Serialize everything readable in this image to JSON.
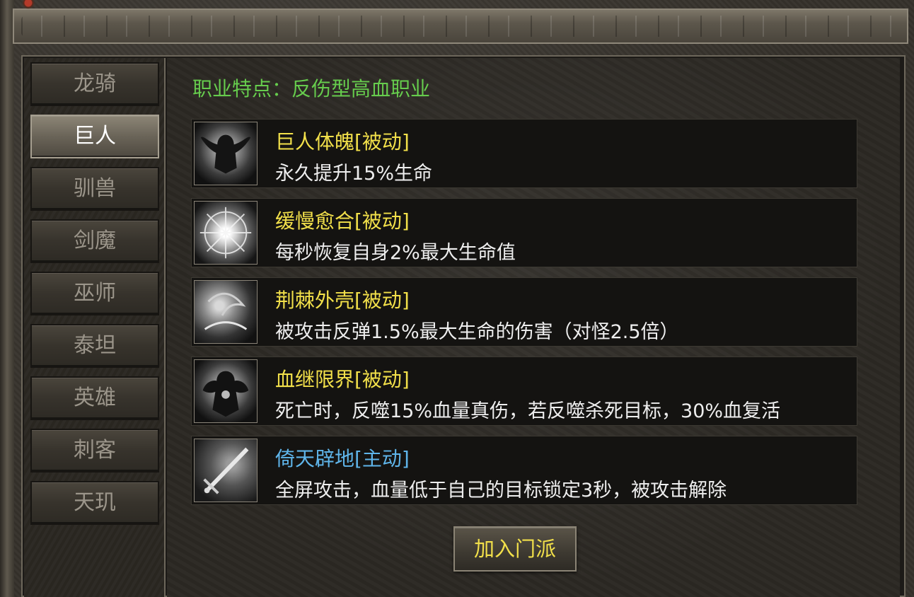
{
  "tabs": [
    {
      "label": "龙骑",
      "active": false
    },
    {
      "label": "巨人",
      "active": true
    },
    {
      "label": "驯兽",
      "active": false
    },
    {
      "label": "剑魔",
      "active": false
    },
    {
      "label": "巫师",
      "active": false
    },
    {
      "label": "泰坦",
      "active": false
    },
    {
      "label": "英雄",
      "active": false
    },
    {
      "label": "刺客",
      "active": false
    },
    {
      "label": "天玑",
      "active": false
    }
  ],
  "trait": "职业特点：反伤型高血职业",
  "skills": [
    {
      "name": "巨人体魄[被动]",
      "desc": "永久提升15%生命",
      "icon": "giant-body-icon"
    },
    {
      "name": "缓慢愈合[被动]",
      "desc": "每秒恢复自身2%最大生命值",
      "icon": "radiant-heal-icon"
    },
    {
      "name": "荆棘外壳[被动]",
      "desc": "被攻击反弹1.5%最大生命的伤害（对怪2.5倍）",
      "icon": "thorn-shell-icon"
    },
    {
      "name": "血继限界[被动]",
      "desc": "死亡时，反噬15%血量真伤，若反噬杀死目标，30%血复活",
      "icon": "bloodline-limit-icon"
    },
    {
      "name": "倚天辟地[主动]",
      "desc": "全屏攻击，血量低于自己的目标锁定3秒，被攻击解除",
      "icon": "sword-strike-icon"
    }
  ],
  "join_button": "加入门派",
  "colors": {
    "passive": "#f2e04a",
    "active": "#5fb5ea",
    "trait": "#66cc4d"
  }
}
